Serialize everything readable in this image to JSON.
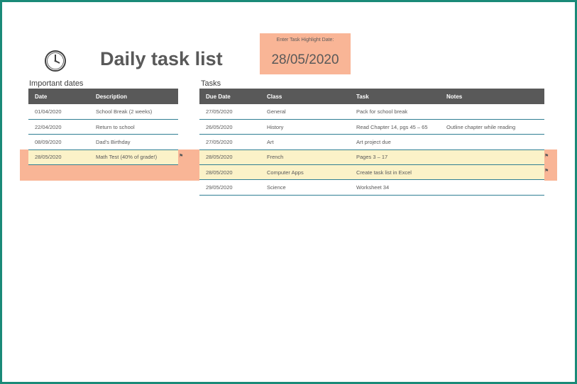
{
  "title": "Daily task list",
  "highlight": {
    "label": "Enter Task Highlight Date:",
    "value": "28/05/2020"
  },
  "important_dates": {
    "section_title": "Important dates",
    "columns": [
      "Date",
      "Description"
    ],
    "rows": [
      {
        "date": "01/04/2020",
        "description": "School Break (2 weeks)",
        "highlighted": false
      },
      {
        "date": "22/04/2020",
        "description": "Return to school",
        "highlighted": false
      },
      {
        "date": "08/09/2020",
        "description": "Dad's Birthday",
        "highlighted": false
      },
      {
        "date": "28/05/2020",
        "description": "Math Test (40% of grade!)",
        "highlighted": true
      }
    ]
  },
  "tasks": {
    "section_title": "Tasks",
    "columns": [
      "Due Date",
      "Class",
      "Task",
      "Notes"
    ],
    "rows": [
      {
        "due_date": "27/05/2020",
        "class": "General",
        "task": "Pack for school break",
        "notes": "",
        "highlighted": false
      },
      {
        "due_date": "26/05/2020",
        "class": "History",
        "task": "Read Chapter 14, pgs 45 – 65",
        "notes": "Outline chapter while reading",
        "highlighted": false
      },
      {
        "due_date": "27/05/2020",
        "class": "Art",
        "task": "Art project due",
        "notes": "",
        "highlighted": false
      },
      {
        "due_date": "28/05/2020",
        "class": "French",
        "task": "Pages 3 – 17",
        "notes": "",
        "highlighted": true
      },
      {
        "due_date": "28/05/2020",
        "class": "Computer Apps",
        "task": "Create task list in Excel",
        "notes": "",
        "highlighted": true
      },
      {
        "due_date": "29/05/2020",
        "class": "Science",
        "task": "Worksheet 34",
        "notes": "",
        "highlighted": false
      }
    ]
  },
  "flag_glyph": "⚑",
  "colors": {
    "frame": "#1a8a78",
    "header_bg": "#595959",
    "highlight_orange": "#f9b596",
    "highlight_yellow": "#fbf2c8",
    "row_border": "#2f7f93"
  },
  "icons": {
    "clock": "clock-icon",
    "flag": "flag-icon"
  }
}
